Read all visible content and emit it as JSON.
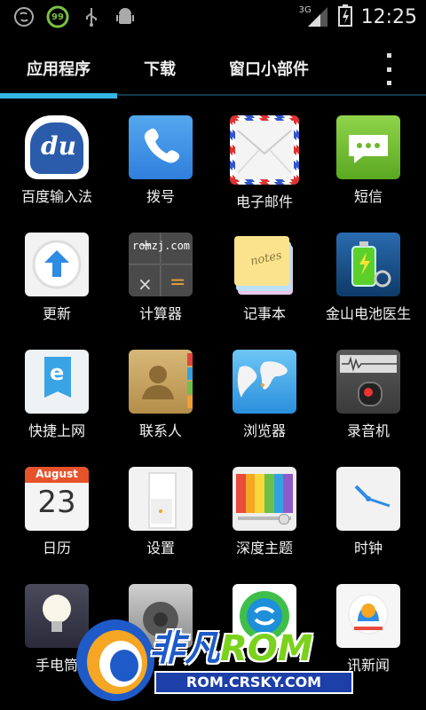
{
  "status_bar": {
    "time": "12:25",
    "network": "3G",
    "battery_badge": "99",
    "icons": [
      "sync-icon",
      "battery-badge-icon",
      "usb-icon",
      "android-debug-icon",
      "signal-icon",
      "battery-icon"
    ]
  },
  "tabs": [
    {
      "label": "应用程序",
      "selected": true
    },
    {
      "label": "下载",
      "selected": false
    },
    {
      "label": "窗口小部件",
      "selected": false
    }
  ],
  "apps": [
    {
      "label": "百度输入法",
      "icon": "baidu-input-icon",
      "icon_text": "du"
    },
    {
      "label": "拨号",
      "icon": "phone-icon"
    },
    {
      "label": "电子邮件",
      "icon": "email-icon"
    },
    {
      "label": "短信",
      "icon": "sms-icon"
    },
    {
      "label": "更新",
      "icon": "update-icon"
    },
    {
      "label": "计算器",
      "icon": "calculator-icon",
      "icon_text": "romzj.com"
    },
    {
      "label": "记事本",
      "icon": "notes-icon",
      "icon_text": "notes"
    },
    {
      "label": "金山电池医生",
      "icon": "battery-doctor-icon"
    },
    {
      "label": "快捷上网",
      "icon": "browser-e-icon",
      "icon_text": "e"
    },
    {
      "label": "联系人",
      "icon": "contacts-icon"
    },
    {
      "label": "浏览器",
      "icon": "globe-icon"
    },
    {
      "label": "录音机",
      "icon": "recorder-icon"
    },
    {
      "label": "日历",
      "icon": "calendar-icon",
      "icon_text": "August",
      "icon_num": "23"
    },
    {
      "label": "设置",
      "icon": "settings-switch-icon"
    },
    {
      "label": "深度主题",
      "icon": "theme-icon"
    },
    {
      "label": "时钟",
      "icon": "clock-icon"
    },
    {
      "label": "手电筒",
      "icon": "flashlight-icon"
    },
    {
      "label": "",
      "icon": "safe-icon"
    },
    {
      "label": "",
      "icon": "sync-app-icon"
    },
    {
      "label": "讯新闻",
      "icon": "qq-news-icon"
    }
  ],
  "watermark": {
    "brand_a": "非凡",
    "brand_b": "ROM",
    "url": "ROM.CRSKY.COM"
  },
  "colors": {
    "accent": "#33b5e5",
    "background": "#000000"
  }
}
